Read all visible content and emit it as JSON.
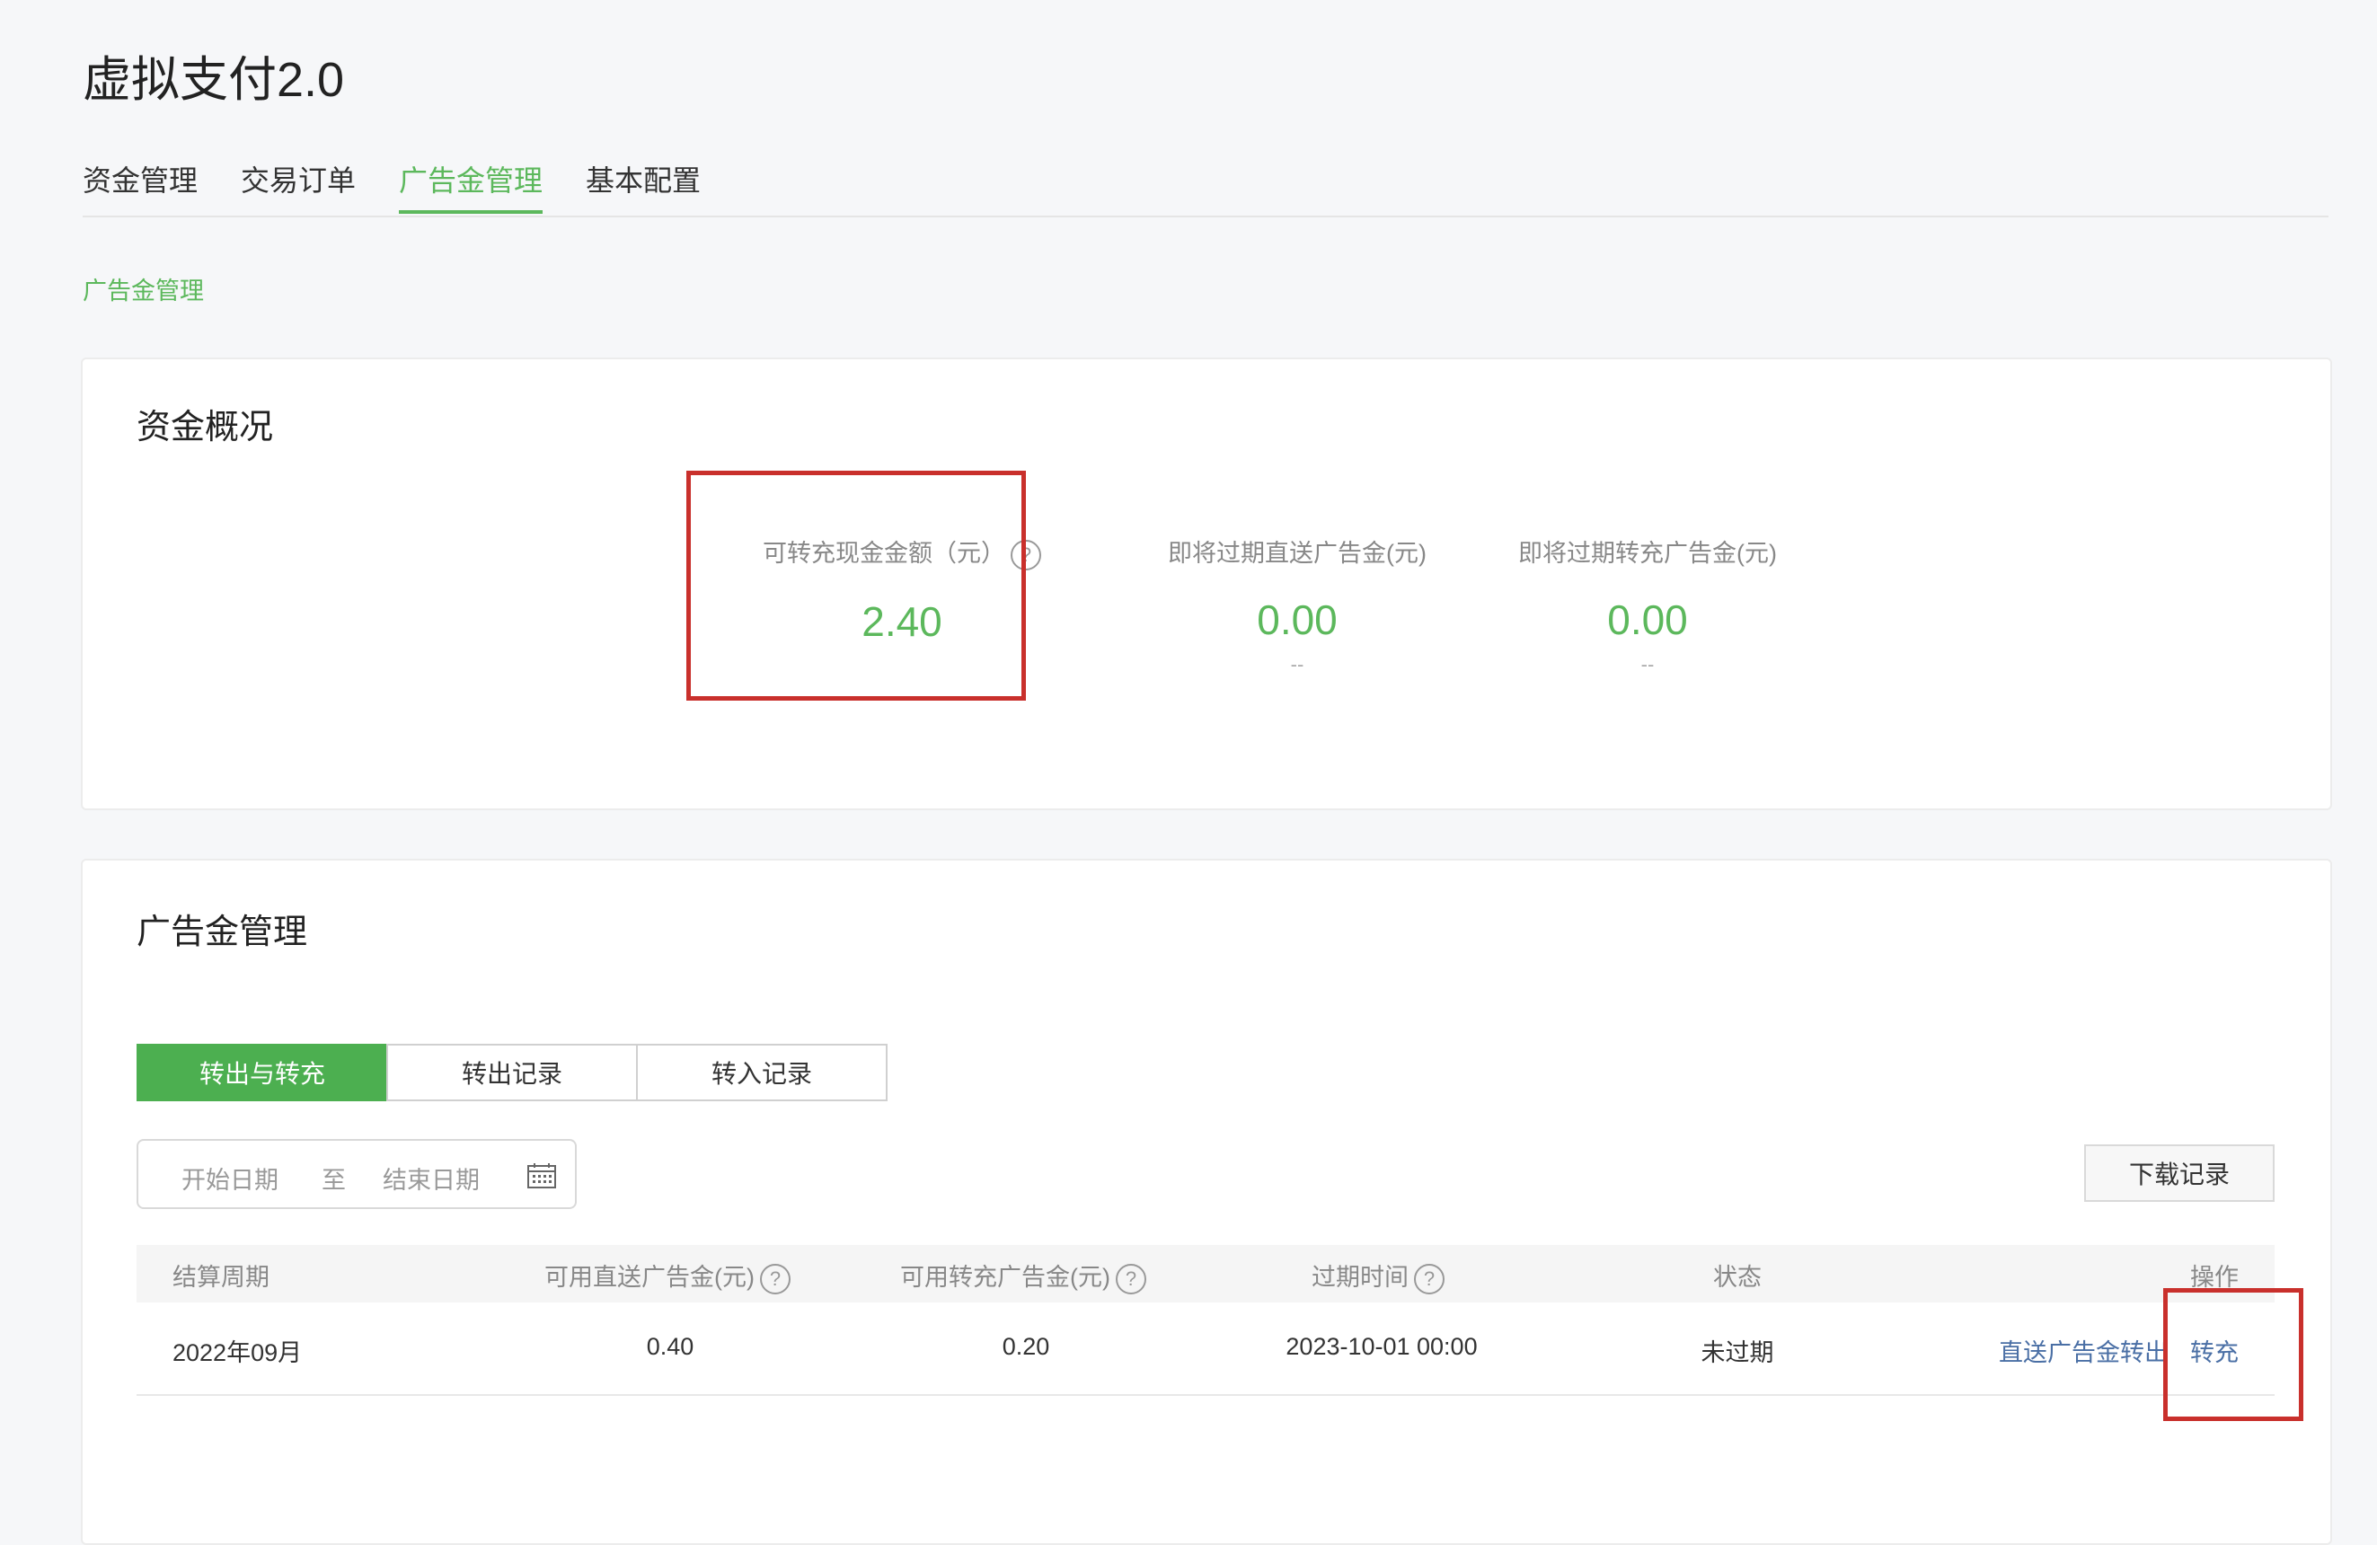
{
  "app": {
    "title": "虚拟支付2.0"
  },
  "tabs": [
    {
      "label": "资金管理"
    },
    {
      "label": "交易订单"
    },
    {
      "label": "广告金管理"
    },
    {
      "label": "基本配置"
    }
  ],
  "breadcrumb": "广告金管理",
  "overview": {
    "title": "资金概况",
    "stats": [
      {
        "label": "可转充现金金额（元）",
        "value": "2.40",
        "sub": ""
      },
      {
        "label": "即将过期直送广告金(元)",
        "value": "0.00",
        "sub": "--"
      },
      {
        "label": "即将过期转充广告金(元)",
        "value": "0.00",
        "sub": "--"
      }
    ]
  },
  "ad_funds": {
    "title": "广告金管理",
    "segments": [
      {
        "label": "转出与转充"
      },
      {
        "label": "转出记录"
      },
      {
        "label": "转入记录"
      }
    ],
    "date_filter": {
      "start_placeholder": "开始日期",
      "separator": "至",
      "end_placeholder": "结束日期"
    },
    "download_label": "下载记录",
    "columns": [
      "结算周期",
      "可用直送广告金(元)",
      "可用转充广告金(元)",
      "过期时间",
      "状态",
      "操作"
    ],
    "rows": [
      {
        "period": "2022年09月",
        "direct": "0.40",
        "transfer": "0.20",
        "expire": "2023-10-01 00:00",
        "status": "未过期",
        "action_out": "直送广告金转出",
        "action_recharge": "转充"
      }
    ]
  },
  "help_glyph": "?",
  "colors": {
    "accent": "#5cb85c",
    "link": "#4a6fa5",
    "highlight": "#c9302c"
  }
}
